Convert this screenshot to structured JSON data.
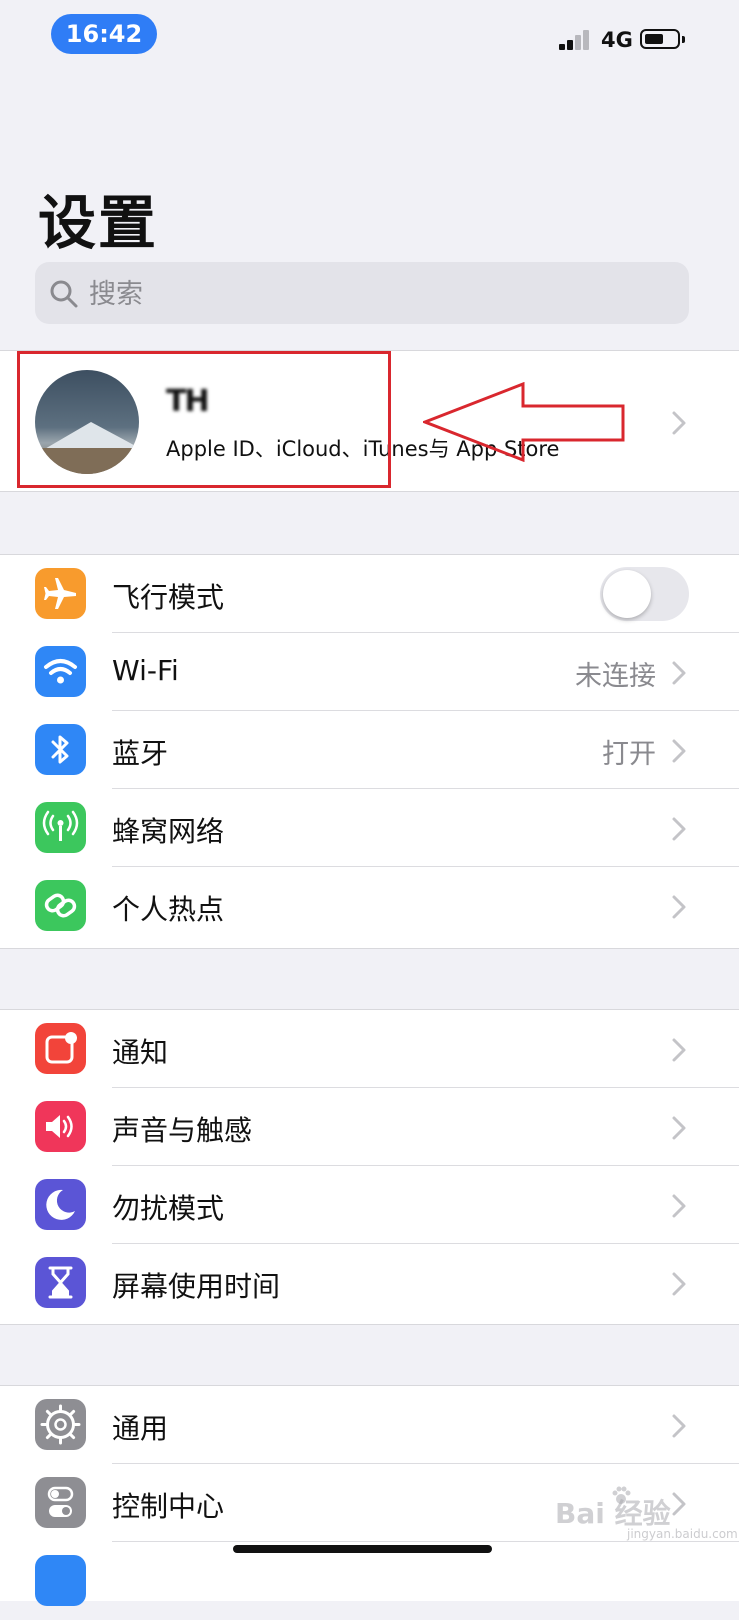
{
  "status_bar": {
    "time": "16:42",
    "network": "4G"
  },
  "header": {
    "title": "设置"
  },
  "search": {
    "placeholder": "搜索"
  },
  "profile": {
    "name": "TH",
    "subtitle": "Apple ID、iCloud、iTunes与 App Store"
  },
  "groups": [
    {
      "rows": [
        {
          "label": "飞行模式",
          "icon": "airplane-icon",
          "color": "#f89b2d",
          "control": "toggle",
          "value": ""
        },
        {
          "label": "Wi-Fi",
          "icon": "wifi-icon",
          "color": "#2f87f6",
          "control": "chevron",
          "value": "未连接"
        },
        {
          "label": "蓝牙",
          "icon": "bluetooth-icon",
          "color": "#2f87f6",
          "control": "chevron",
          "value": "打开"
        },
        {
          "label": "蜂窝网络",
          "icon": "cellular-antenna-icon",
          "color": "#3cc75d",
          "control": "chevron",
          "value": ""
        },
        {
          "label": "个人热点",
          "icon": "hotspot-link-icon",
          "color": "#3cc75d",
          "control": "chevron",
          "value": ""
        }
      ]
    },
    {
      "rows": [
        {
          "label": "通知",
          "icon": "notifications-icon",
          "color": "#f2443a",
          "control": "chevron",
          "value": ""
        },
        {
          "label": "声音与触感",
          "icon": "speaker-icon",
          "color": "#f0365a",
          "control": "chevron",
          "value": ""
        },
        {
          "label": "勿扰模式",
          "icon": "moon-icon",
          "color": "#5b55d6",
          "control": "chevron",
          "value": ""
        },
        {
          "label": "屏幕使用时间",
          "icon": "hourglass-icon",
          "color": "#5b55d6",
          "control": "chevron",
          "value": ""
        }
      ]
    },
    {
      "rows": [
        {
          "label": "通用",
          "icon": "gear-icon",
          "color": "#8e8e93",
          "control": "chevron",
          "value": ""
        },
        {
          "label": "控制中心",
          "icon": "switches-icon",
          "color": "#8e8e93",
          "control": "chevron",
          "value": ""
        }
      ]
    }
  ],
  "watermark": {
    "text": "Bai 经验",
    "sub": "jingyan.baidu.com"
  }
}
